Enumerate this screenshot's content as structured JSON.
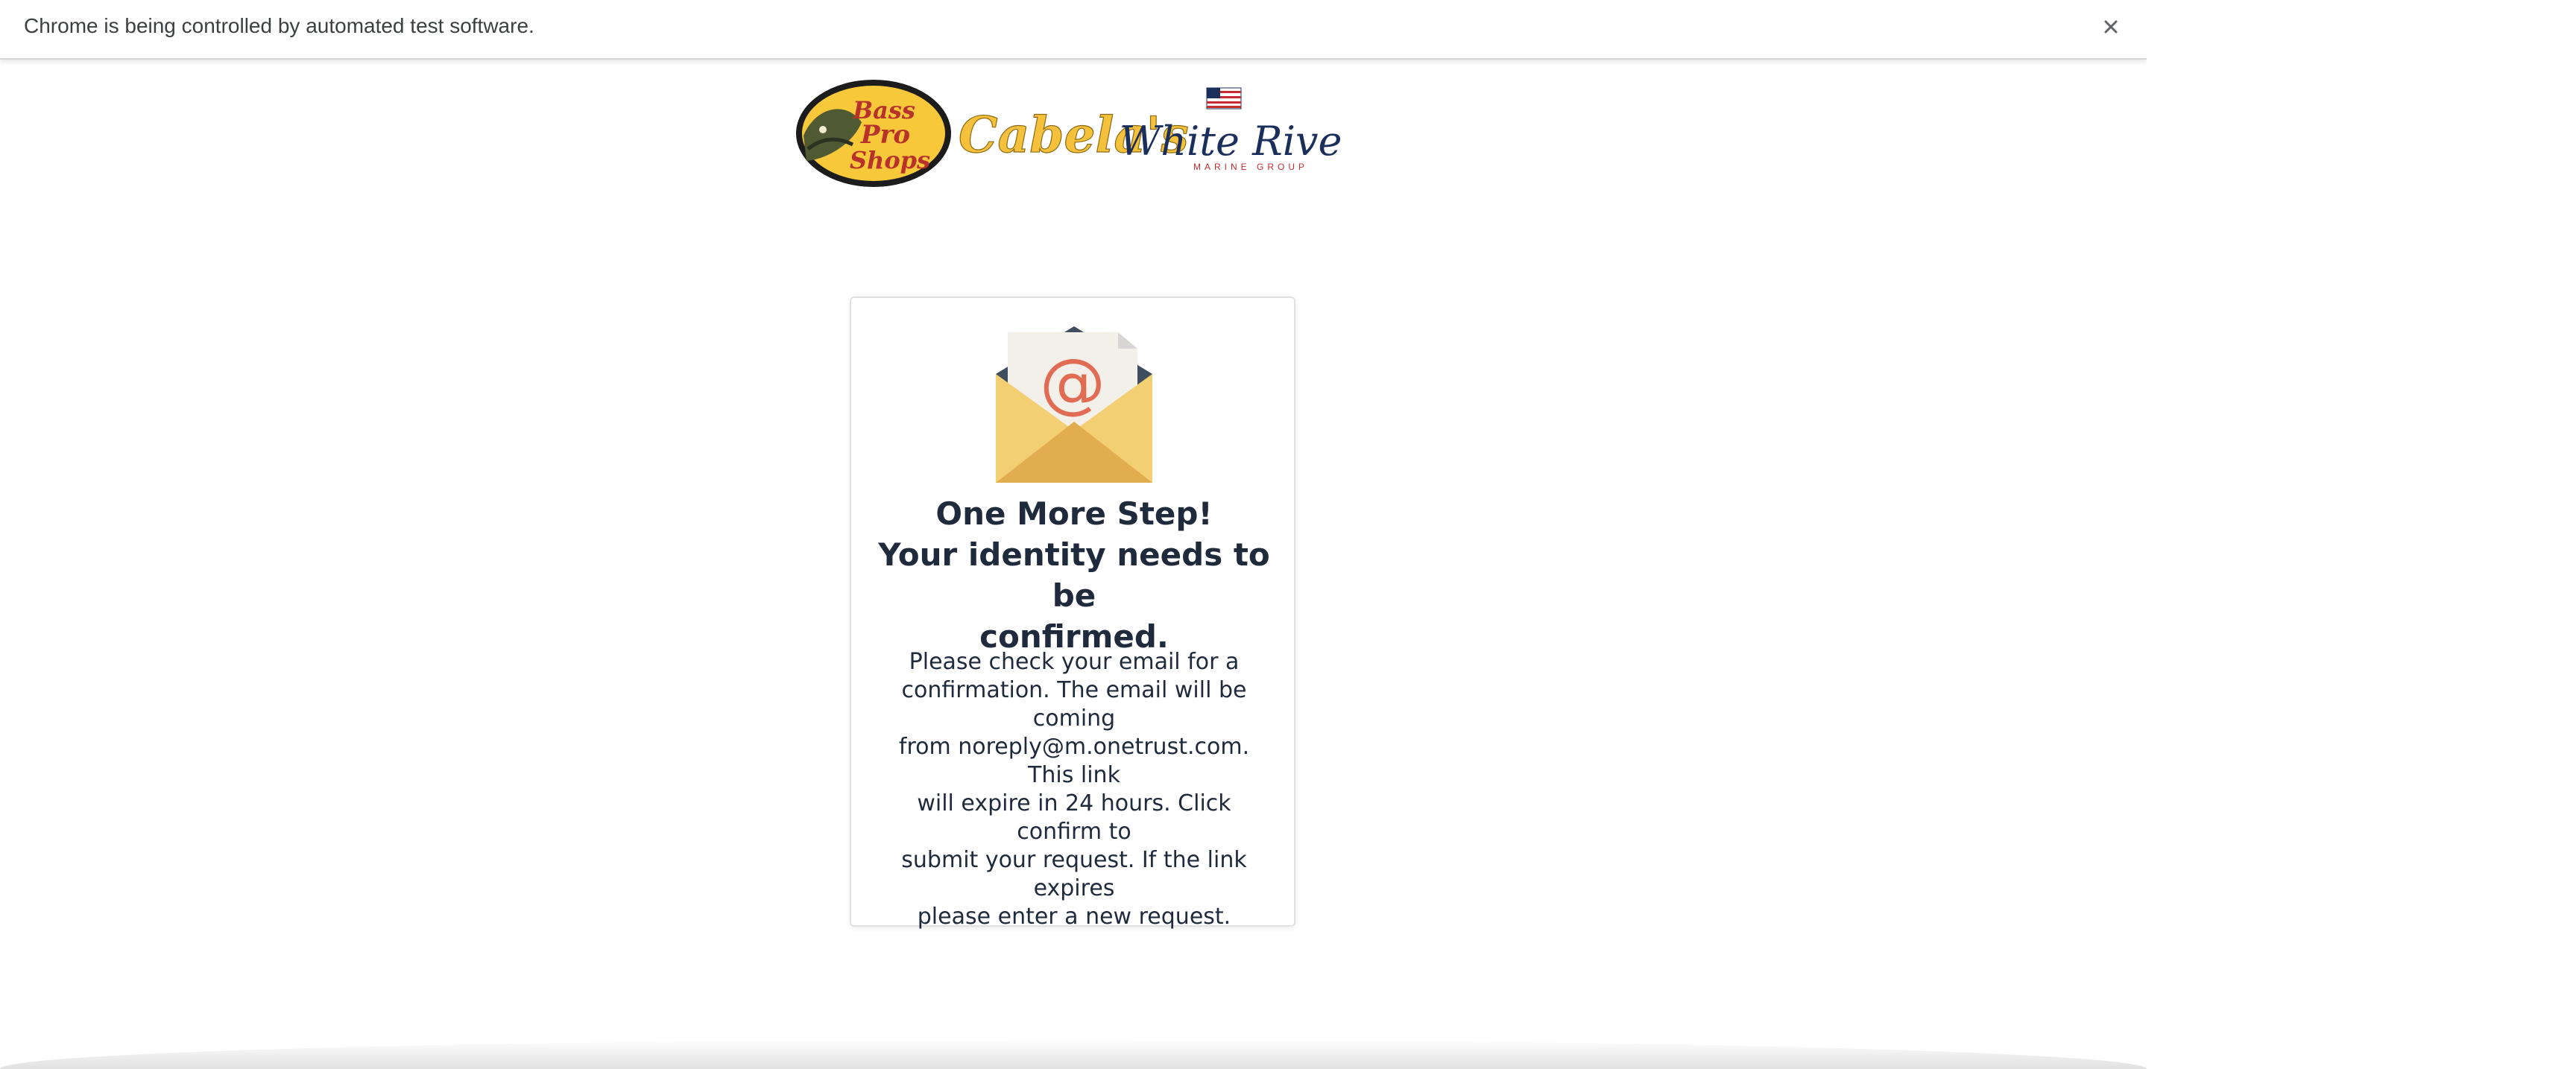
{
  "infobar": {
    "message": "Chrome is being controlled by automated test software.",
    "close_icon": "close-icon"
  },
  "logos": {
    "bass_pro": {
      "line1": "Bass",
      "line2": "Pro",
      "line3": "Shops"
    },
    "cabelas": "Cabela's",
    "white_river": {
      "name": "White River",
      "tagline": "MARINE GROUP"
    }
  },
  "card": {
    "icon": "email-envelope-icon",
    "heading_line1": "One More Step!",
    "heading_line2": "Your identity needs to be",
    "heading_line3": "confirmed.",
    "message_line1": "Please check your email for a",
    "message_line2": "confirmation. The email will be coming",
    "message_line3": "from noreply@m.onetrust.com. This link",
    "message_line4": "will expire in 24 hours. Click confirm to",
    "message_line5": "submit your request. If the link expires",
    "message_line6": "please enter a new request."
  },
  "colors": {
    "heading_text": "#1f2a3d",
    "envelope_yellow": "#f2cf72",
    "envelope_dark": "#e2ad4f",
    "envelope_flap": "#3f4e5e",
    "at_sign": "#e16b53",
    "bass_pro_yellow": "#f6c83a",
    "cabelas_yellow": "#f5c13c",
    "white_river_navy": "#1b2f5c"
  }
}
